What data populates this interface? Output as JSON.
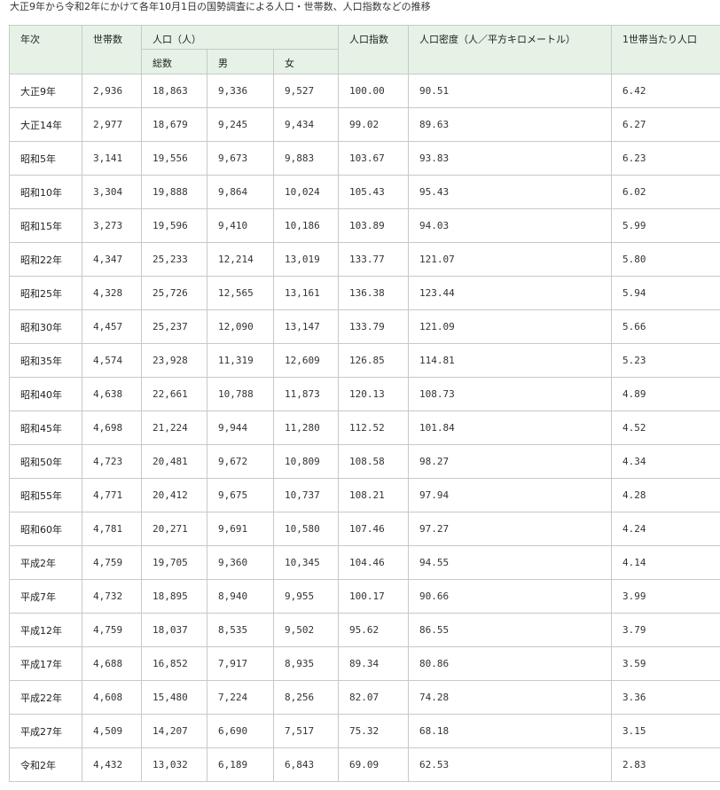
{
  "caption": "大正9年から令和2年にかけて各年10月1日の国勢調査による人口・世帯数、人口指数などの推移",
  "table": {
    "headers": {
      "year": "年次",
      "households": "世帯数",
      "population": "人口（人）",
      "total": "総数",
      "male": "男",
      "female": "女",
      "index": "人口指数",
      "density": "人口密度（人／平方キロメートル）",
      "per_household": "1世帯当たり人口"
    },
    "rows": [
      {
        "year": "大正9年",
        "households": "2,936",
        "total": "18,863",
        "male": "9,336",
        "female": "9,527",
        "index": "100.00",
        "density": "90.51",
        "per_household": "6.42"
      },
      {
        "year": "大正14年",
        "households": "2,977",
        "total": "18,679",
        "male": "9,245",
        "female": "9,434",
        "index": "99.02",
        "density": "89.63",
        "per_household": "6.27"
      },
      {
        "year": "昭和5年",
        "households": "3,141",
        "total": "19,556",
        "male": "9,673",
        "female": "9,883",
        "index": "103.67",
        "density": "93.83",
        "per_household": "6.23"
      },
      {
        "year": "昭和10年",
        "households": "3,304",
        "total": "19,888",
        "male": "9,864",
        "female": "10,024",
        "index": "105.43",
        "density": "95.43",
        "per_household": "6.02"
      },
      {
        "year": "昭和15年",
        "households": "3,273",
        "total": "19,596",
        "male": "9,410",
        "female": "10,186",
        "index": "103.89",
        "density": "94.03",
        "per_household": "5.99"
      },
      {
        "year": "昭和22年",
        "households": "4,347",
        "total": "25,233",
        "male": "12,214",
        "female": "13,019",
        "index": "133.77",
        "density": "121.07",
        "per_household": "5.80"
      },
      {
        "year": "昭和25年",
        "households": "4,328",
        "total": "25,726",
        "male": "12,565",
        "female": "13,161",
        "index": "136.38",
        "density": "123.44",
        "per_household": "5.94"
      },
      {
        "year": "昭和30年",
        "households": "4,457",
        "total": "25,237",
        "male": "12,090",
        "female": "13,147",
        "index": "133.79",
        "density": "121.09",
        "per_household": "5.66"
      },
      {
        "year": "昭和35年",
        "households": "4,574",
        "total": "23,928",
        "male": "11,319",
        "female": "12,609",
        "index": "126.85",
        "density": "114.81",
        "per_household": "5.23"
      },
      {
        "year": "昭和40年",
        "households": "4,638",
        "total": "22,661",
        "male": "10,788",
        "female": "11,873",
        "index": "120.13",
        "density": "108.73",
        "per_household": "4.89"
      },
      {
        "year": "昭和45年",
        "households": "4,698",
        "total": "21,224",
        "male": "9,944",
        "female": "11,280",
        "index": "112.52",
        "density": "101.84",
        "per_household": "4.52"
      },
      {
        "year": "昭和50年",
        "households": "4,723",
        "total": "20,481",
        "male": "9,672",
        "female": "10,809",
        "index": "108.58",
        "density": "98.27",
        "per_household": "4.34"
      },
      {
        "year": "昭和55年",
        "households": "4,771",
        "total": "20,412",
        "male": "9,675",
        "female": "10,737",
        "index": "108.21",
        "density": "97.94",
        "per_household": "4.28"
      },
      {
        "year": "昭和60年",
        "households": "4,781",
        "total": "20,271",
        "male": "9,691",
        "female": "10,580",
        "index": "107.46",
        "density": "97.27",
        "per_household": "4.24"
      },
      {
        "year": "平成2年",
        "households": "4,759",
        "total": "19,705",
        "male": "9,360",
        "female": "10,345",
        "index": "104.46",
        "density": "94.55",
        "per_household": "4.14"
      },
      {
        "year": "平成7年",
        "households": "4,732",
        "total": "18,895",
        "male": "8,940",
        "female": "9,955",
        "index": "100.17",
        "density": "90.66",
        "per_household": "3.99"
      },
      {
        "year": "平成12年",
        "households": "4,759",
        "total": "18,037",
        "male": "8,535",
        "female": "9,502",
        "index": "95.62",
        "density": "86.55",
        "per_household": "3.79"
      },
      {
        "year": "平成17年",
        "households": "4,688",
        "total": "16,852",
        "male": "7,917",
        "female": "8,935",
        "index": "89.34",
        "density": "80.86",
        "per_household": "3.59"
      },
      {
        "year": "平成22年",
        "households": "4,608",
        "total": "15,480",
        "male": "7,224",
        "female": "8,256",
        "index": "82.07",
        "density": "74.28",
        "per_household": "3.36"
      },
      {
        "year": "平成27年",
        "households": "4,509",
        "total": "14,207",
        "male": "6,690",
        "female": "7,517",
        "index": "75.32",
        "density": "68.18",
        "per_household": "3.15"
      },
      {
        "year": "令和2年",
        "households": "4,432",
        "total": "13,032",
        "male": "6,189",
        "female": "6,843",
        "index": "69.09",
        "density": "62.53",
        "per_household": "2.83"
      }
    ]
  }
}
